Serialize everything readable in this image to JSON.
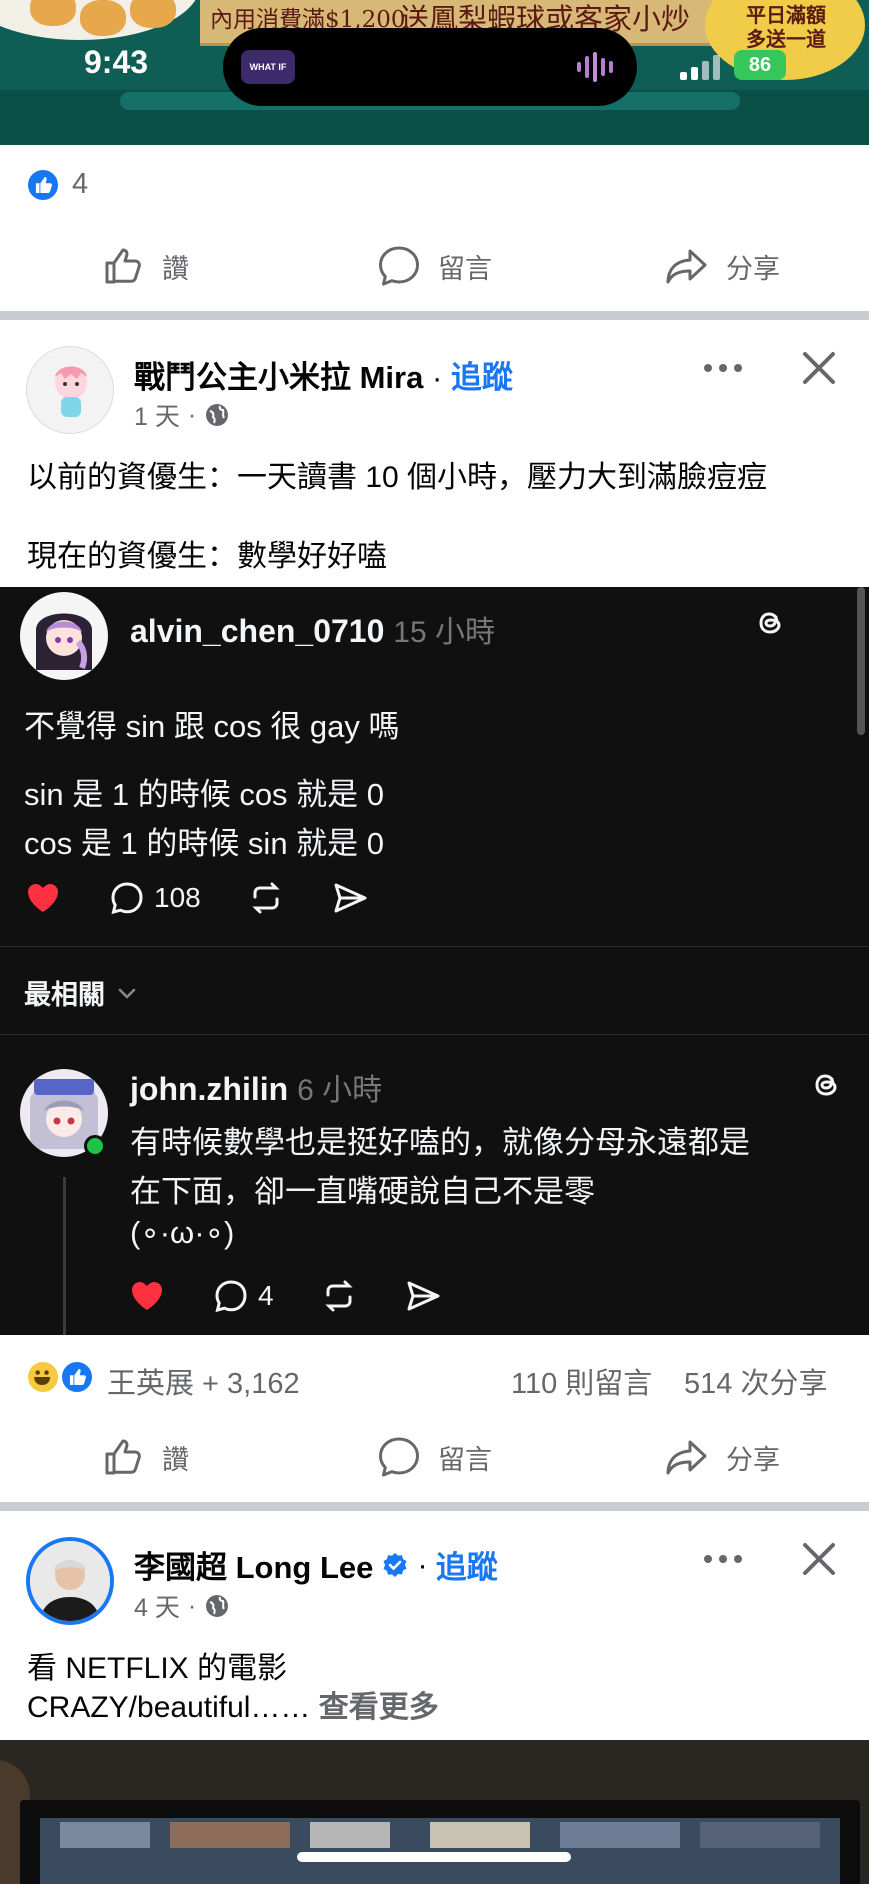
{
  "status_bar": {
    "time": "9:43",
    "battery": "86",
    "now_playing": "WHAT IF"
  },
  "banner": {
    "promo_small": "內用消費滿$1,200",
    "promo_big": "送鳳梨蝦球或客家小炒",
    "badge_line1": "平日滿額",
    "badge_line2": "多送一道"
  },
  "post1": {
    "like_count": "4",
    "actions": {
      "like": "讚",
      "comment": "留言",
      "share": "分享"
    }
  },
  "post2": {
    "author": "戰鬥公主小米拉 Mira",
    "follow": "追蹤",
    "time": "1 天",
    "text_line1": "以前的資優生：一天讀書 10 個小時，壓力大到滿臉痘痘",
    "text_line2": "現在的資優生：數學好好嗑",
    "threads": {
      "main": {
        "username": "alvin_chen_0710",
        "time": "15 小時",
        "line1": "不覺得 sin 跟 cos 很 gay 嗎",
        "line2": "sin 是 1 的時候 cos 就是 0",
        "line3": "cos 是 1 的時候 sin 就是 0",
        "replies": "108"
      },
      "sort_label": "最相關",
      "reply": {
        "username": "john.zhilin",
        "time": "6 小時",
        "line1": "有時候數學也是挺好嗑的，就像分母永遠都是",
        "line2": "在下面，卻一直嘴硬說自己不是零",
        "line3": "(∘·ω·∘)",
        "replies": "4"
      }
    },
    "reactions": "王英展 + 3,162",
    "comments": "110 則留言",
    "shares": "514 次分享",
    "actions": {
      "like": "讚",
      "comment": "留言",
      "share": "分享"
    }
  },
  "post3": {
    "author": "李國超 Long Lee",
    "follow": "追蹤",
    "time": "4 天",
    "text_line1": "看 NETFLIX 的電影",
    "text_line2": "CRAZY/beautiful……",
    "see_more": "查看更多"
  },
  "colors": {
    "facebook_blue": "#1877f2",
    "threads_bg": "#101010",
    "heart_red": "#ff3040"
  }
}
